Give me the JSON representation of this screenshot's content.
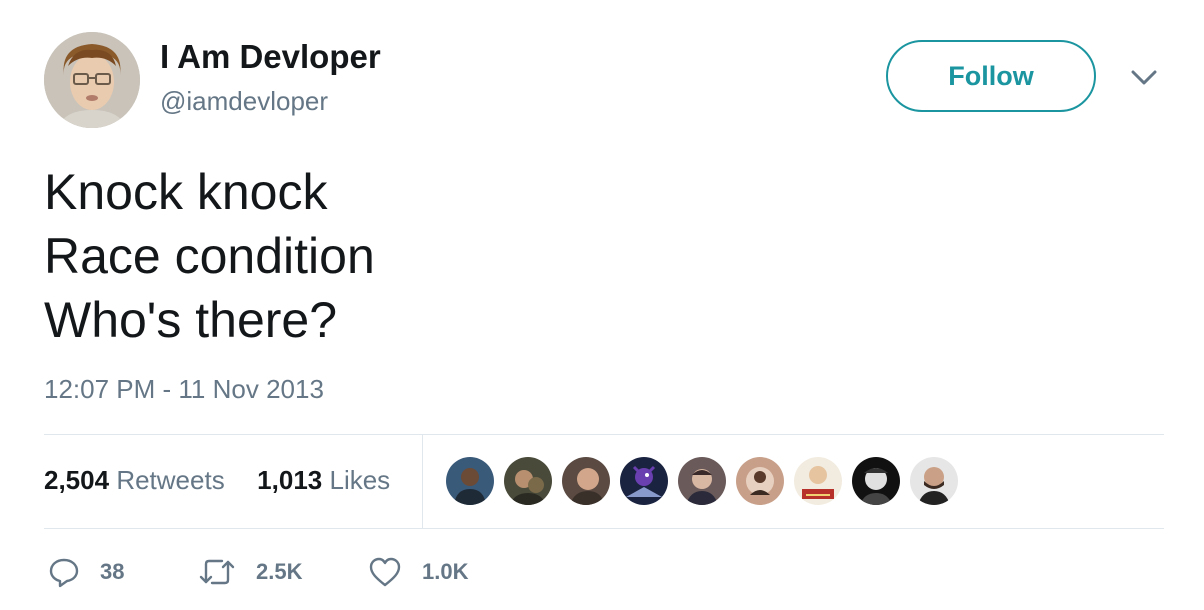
{
  "author": {
    "display_name": "I Am Devloper",
    "handle": "@iamdevloper",
    "avatar_icon": "profile-photo-icon"
  },
  "follow_label": "Follow",
  "tweet": {
    "lines": [
      "Knock knock",
      "Race condition",
      "Who's there?"
    ],
    "timestamp": "12:07 PM - 11 Nov 2013"
  },
  "stats": {
    "retweets_count": "2,504",
    "retweets_label": "Retweets",
    "likes_count": "1,013",
    "likes_label": "Likes"
  },
  "liker_avatars": [
    {
      "icon": "liker-avatar-icon"
    },
    {
      "icon": "liker-avatar-icon"
    },
    {
      "icon": "liker-avatar-icon"
    },
    {
      "icon": "liker-avatar-icon"
    },
    {
      "icon": "liker-avatar-icon"
    },
    {
      "icon": "liker-avatar-icon"
    },
    {
      "icon": "liker-avatar-icon"
    },
    {
      "icon": "liker-avatar-icon"
    },
    {
      "icon": "liker-avatar-icon"
    }
  ],
  "actions": {
    "reply_count": "38",
    "retweet_count": "2.5K",
    "like_count": "1.0K"
  },
  "colors": {
    "accent": "#1b95a0",
    "text": "#14171a",
    "muted": "#657786",
    "divider": "#e1e8ed"
  }
}
